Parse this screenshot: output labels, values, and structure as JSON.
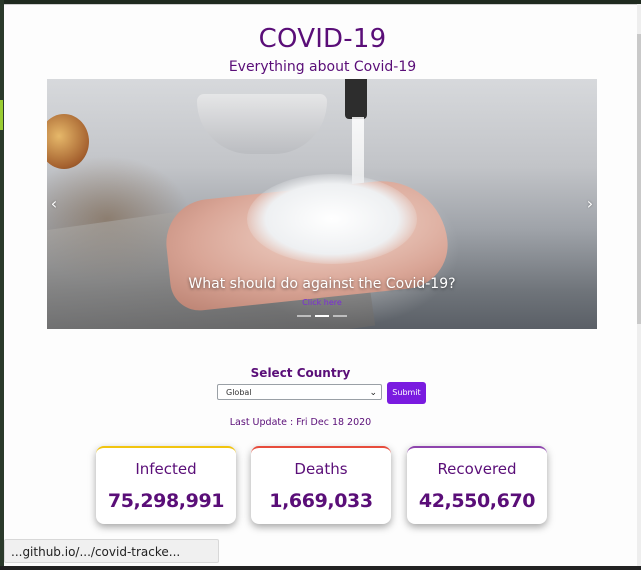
{
  "header": {
    "title": "COVID-19",
    "subtitle": "Everything about Covid-19"
  },
  "carousel": {
    "caption": "What should do against the Covid-19?",
    "link_label": "Click here",
    "prev_icon": "chevron-left-icon",
    "next_icon": "chevron-right-icon"
  },
  "country": {
    "label": "Select Country",
    "selected": "Global",
    "submit_label": "Submit"
  },
  "last_update": "Last Update : Fri Dec 18 2020",
  "stats": [
    {
      "label": "Infected",
      "value": "75,298,991",
      "color": "#f1c40f"
    },
    {
      "label": "Deaths",
      "value": "1,669,033",
      "color": "#e74c3c"
    },
    {
      "label": "Recovered",
      "value": "42,550,670",
      "color": "#8e44ad"
    }
  ],
  "statusbar": {
    "text": "...github.io/.../covid-tracke..."
  },
  "colors": {
    "primary": "#5a0e78",
    "button": "#7a1be0"
  }
}
